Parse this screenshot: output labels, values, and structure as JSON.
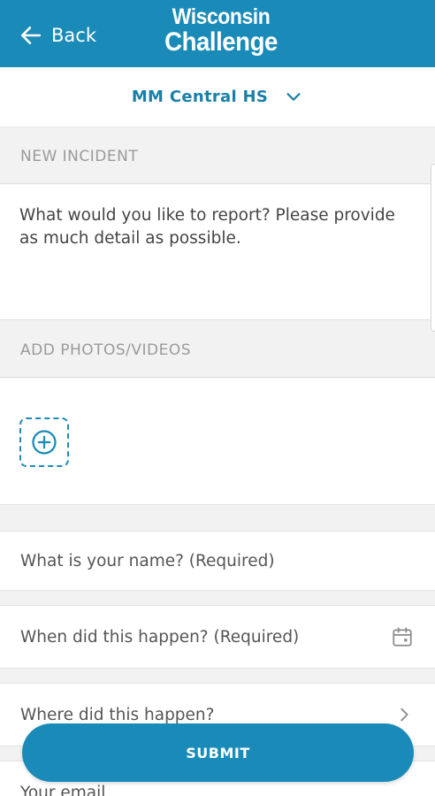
{
  "header": {
    "back_label": "Back",
    "logo_line1": "Wisconsin",
    "logo_line2": "Challenge",
    "icon": "arrow-left-icon",
    "background_color": "#1a8bb8"
  },
  "school_selector": {
    "selected": "MM Central HS",
    "icon": "chevron-down-icon"
  },
  "incident": {
    "section_title": "NEW INCIDENT",
    "placeholder": "What would you like to report? Please provide as much detail as possible."
  },
  "photos": {
    "section_title": "ADD PHOTOS/VIDEOS",
    "icon": "plus-circle-icon"
  },
  "fields": {
    "name_placeholder": "What is your name? (Required)",
    "date_placeholder": "When did this happen? (Required)",
    "date_icon": "calendar-icon",
    "location_placeholder": "Where did this happen?",
    "location_icon": "chevron-right-icon",
    "email_placeholder": "Your email"
  },
  "submit": {
    "label": "SUBMIT"
  }
}
